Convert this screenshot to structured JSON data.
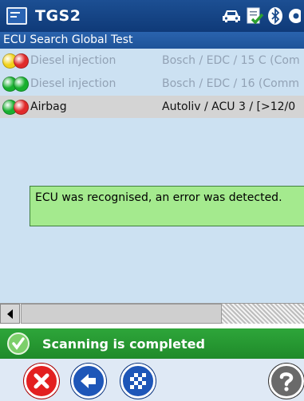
{
  "window": {
    "title": "TGS2",
    "icons": [
      "app-icon",
      "car-icon",
      "document-check-icon",
      "bluetooth-icon",
      "settings-icon"
    ]
  },
  "subtitle": "ECU Search Global Test",
  "ecu_list": [
    {
      "name": "Diesel injection",
      "detail": "Bosch / EDC / 15 C (Com",
      "lamps": [
        "#f1d21a",
        "#e02a2a"
      ],
      "state": "dim"
    },
    {
      "name": "Diesel injection",
      "detail": "Bosch / EDC / 16 (Comm",
      "lamps": [
        "#18b02f",
        "#18b02f"
      ],
      "state": "dim"
    },
    {
      "name": "Airbag",
      "detail": "Autoliv / ACU 3 / [>12/0",
      "lamps": [
        "#18b02f",
        "#e02a2a"
      ],
      "state": "selected"
    }
  ],
  "message": "ECU was recognised, an error was detected.",
  "status": {
    "text": "Scanning is completed",
    "icon": "check-icon",
    "color": "#26a133"
  },
  "toolbar": {
    "buttons": [
      "cancel-icon",
      "back-arrow-icon",
      "checkered-flag-icon",
      "help-icon"
    ]
  },
  "colors": {
    "titlebar": "#1a4b8c",
    "list_background": "#cce1f2",
    "message_background": "#a4ea8e",
    "status_background": "#26a133"
  }
}
